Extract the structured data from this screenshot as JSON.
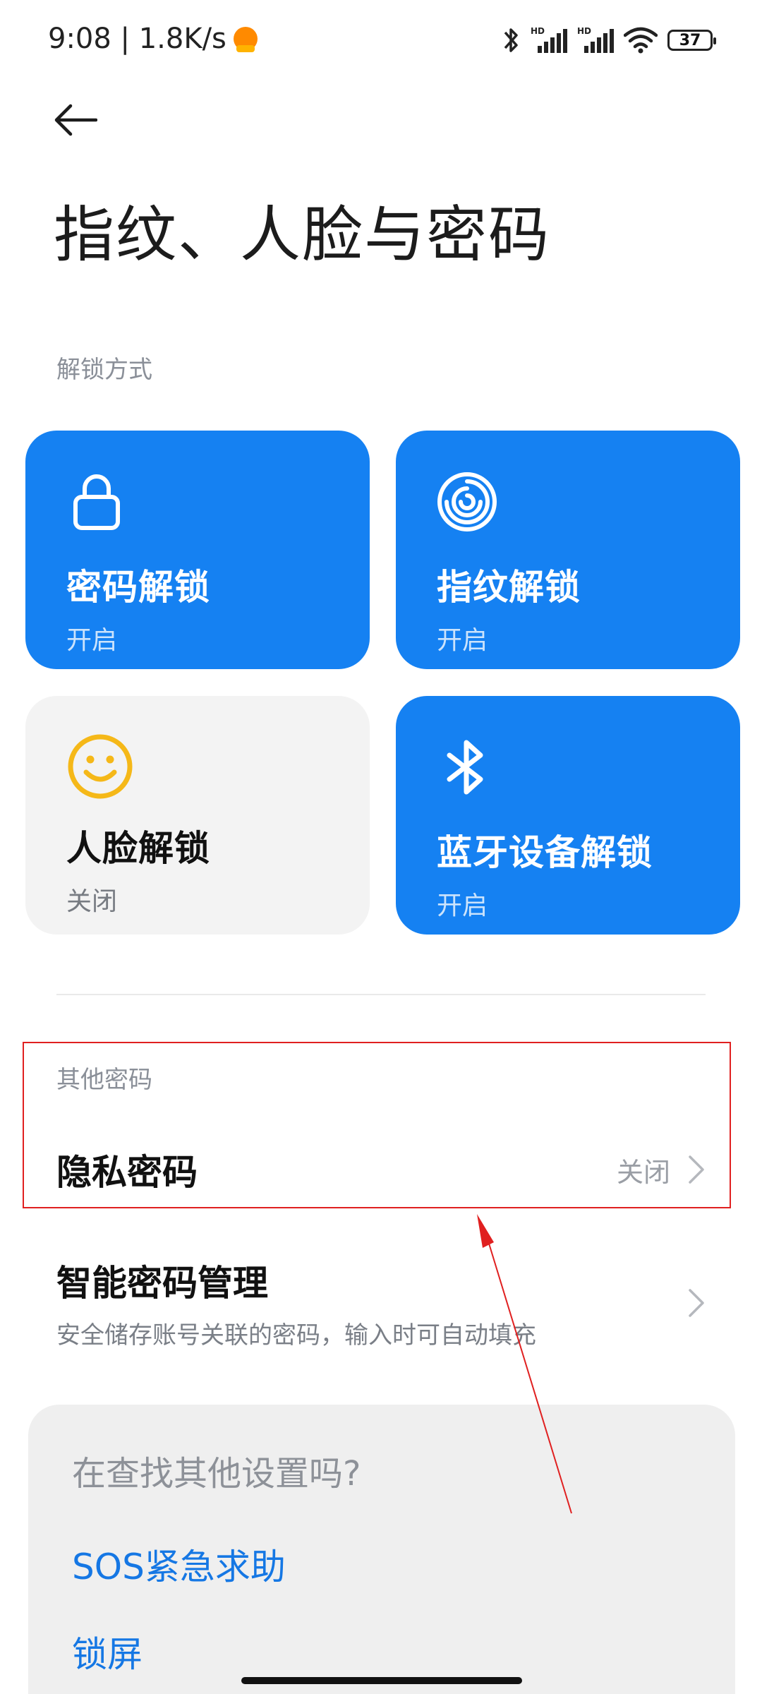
{
  "status_bar": {
    "time_speed": "9:08 | 1.8K/s",
    "battery": "37",
    "icons": [
      "bluetooth-icon",
      "signal-hd-icon",
      "signal-hd-icon",
      "wifi-icon",
      "battery-icon"
    ]
  },
  "page": {
    "title": "指纹、人脸与密码"
  },
  "unlock_section": {
    "label": "解锁方式",
    "tiles": [
      {
        "title": "密码解锁",
        "status": "开启",
        "icon": "lock-icon"
      },
      {
        "title": "指纹解锁",
        "status": "开启",
        "icon": "fingerprint-icon"
      },
      {
        "title": "人脸解锁",
        "status": "关闭",
        "icon": "face-icon"
      },
      {
        "title": "蓝牙设备解锁",
        "status": "开启",
        "icon": "bluetooth-icon"
      }
    ]
  },
  "other_section": {
    "label": "其他密码",
    "privacy_password": {
      "title": "隐私密码",
      "value": "关闭"
    },
    "smart_password": {
      "title": "智能密码管理",
      "subtitle": "安全储存账号关联的密码，输入时可自动填充"
    }
  },
  "search_card": {
    "title": "在查找其他设置吗?",
    "links": [
      "SOS紧急求助",
      "锁屏"
    ]
  },
  "colors": {
    "accent": "#1581f2",
    "link": "#1577e4",
    "annotation": "#e02020"
  }
}
